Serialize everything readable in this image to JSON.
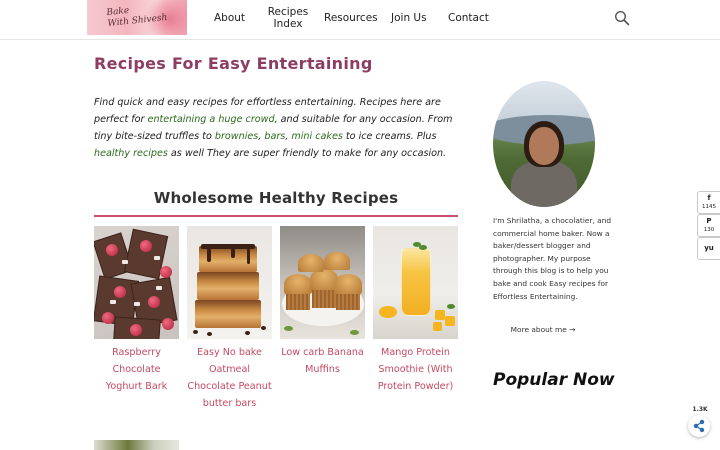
{
  "header": {
    "logo_text_line1": "Bake",
    "logo_text_line2": "With Shivesh",
    "nav": [
      {
        "label": "About"
      },
      {
        "label": "Recipes Index"
      },
      {
        "label": "Resources"
      },
      {
        "label": "Join Us"
      },
      {
        "label": "Contact"
      }
    ],
    "search_icon": "search-icon"
  },
  "main": {
    "title": "Recipes For Easy Entertaining",
    "intro": {
      "t1": "Find quick and easy recipes for effortless entertaining. Recipes here are perfect for ",
      "l1": "entertaining a huge crowd",
      "t2": ", and suitable for any occasion. From tiny bite-sized truffles to ",
      "l2": "brownies",
      "t3": ", ",
      "l3": "bars",
      "t4": ", ",
      "l4": "mini cakes",
      "t5": " to ice creams. Plus ",
      "l5": "healthy recipes",
      "t6": " as well They are super friendly to make for any occasion."
    },
    "section_title": "Wholesome Healthy Recipes",
    "cards": [
      {
        "title": "Raspberry Chocolate Yoghurt Bark"
      },
      {
        "title": "Easy No bake Oatmeal Chocolate Peanut butter bars"
      },
      {
        "title": "Low carb Banana Muffins"
      },
      {
        "title": "Mango Protein Smoothie (With Protein Powder)"
      }
    ]
  },
  "sidebar": {
    "bio": "I'm Shrilatha, a chocolatier, and commercial home baker. Now a baker/dessert blogger and photographer. My purpose through this blog is to help you bake and cook Easy recipes for Effortless Entertaining.",
    "more_link": "More about me →",
    "popular_title": "Popular Now"
  },
  "share": {
    "facebook_count": "1145",
    "pinterest_count": "130",
    "total_count": "1.3K"
  },
  "colors": {
    "title": "#8d3d63",
    "link": "#2f6a1f",
    "card_title": "#c44a62",
    "rule": "#c8506a"
  }
}
